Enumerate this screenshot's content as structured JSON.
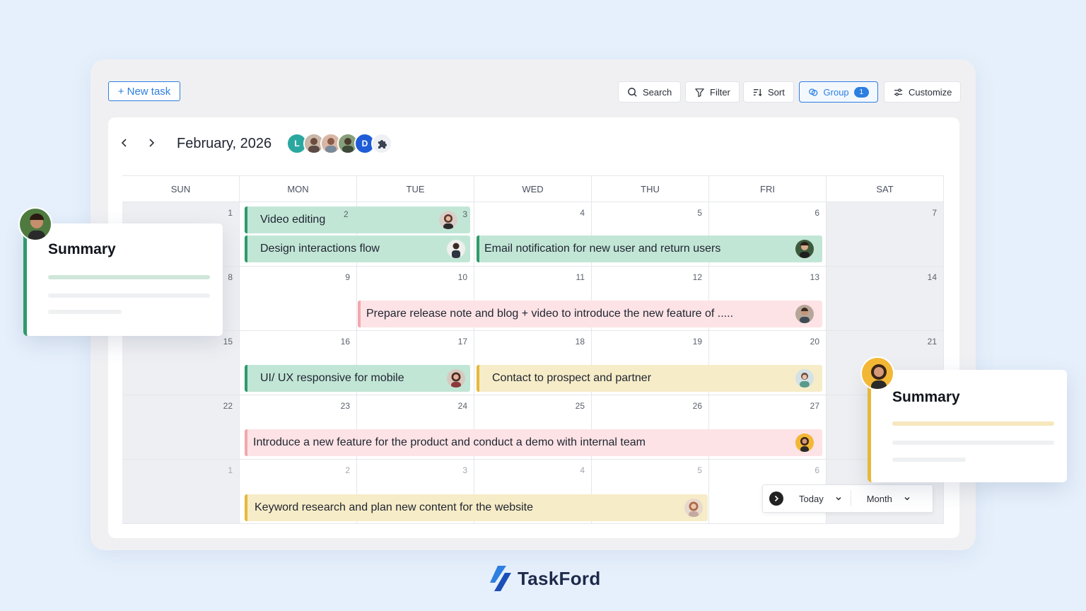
{
  "toolbar": {
    "new_task": "+ New task",
    "search": "Search",
    "filter": "Filter",
    "sort": "Sort",
    "group": "Group",
    "group_count": "1",
    "customize": "Customize"
  },
  "calendar": {
    "month_title": "February, 2026",
    "avatar_initials": [
      "L",
      "D"
    ],
    "weekdays": [
      "SUN",
      "MON",
      "TUE",
      "WED",
      "THU",
      "FRI",
      "SAT"
    ],
    "weeks": [
      [
        "1",
        "2",
        "3",
        "4",
        "5",
        "6",
        "7"
      ],
      [
        "8",
        "9",
        "10",
        "11",
        "12",
        "13",
        "14"
      ],
      [
        "15",
        "16",
        "17",
        "18",
        "19",
        "20",
        "21"
      ],
      [
        "22",
        "23",
        "24",
        "25",
        "26",
        "27",
        ""
      ],
      [
        "1",
        "2",
        "3",
        "4",
        "5",
        "6",
        ""
      ]
    ],
    "events": {
      "video_editing": "Video editing",
      "design_interactions": "Design interactions flow",
      "email_notification": "Email notification for new user and return users",
      "release_note": "Prepare release note and blog + video to introduce the new feature of .....",
      "ui_ux": "UI/ UX responsive for mobile",
      "contact_prospect": "Contact to prospect and partner",
      "introduce_feature": "Introduce a new feature for the product and conduct a demo  with internal team",
      "keyword_research": "Keyword research and plan new content for the website"
    }
  },
  "view_controls": {
    "today": "Today",
    "month": "Month"
  },
  "summary_left": {
    "title": "Summary"
  },
  "summary_right": {
    "title": "Summary"
  },
  "brand": {
    "name": "TaskFord"
  },
  "colors": {
    "accent": "#2d7fe0",
    "green": "#c2e6d6",
    "pink": "#fde3e5",
    "yellow": "#f6ecc7"
  }
}
